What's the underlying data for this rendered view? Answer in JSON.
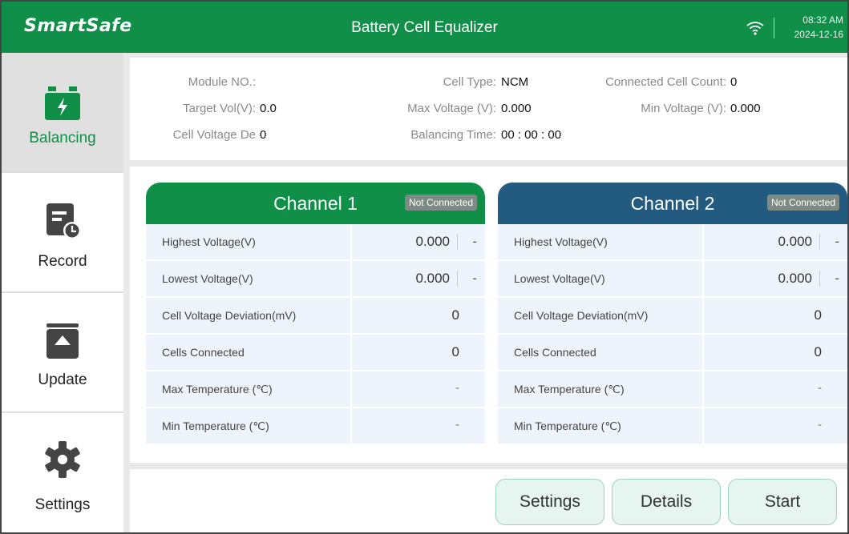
{
  "header": {
    "brand": "SmartSafe",
    "title": "Battery Cell Equalizer",
    "time": "08:32 AM",
    "date": "2024-12-16"
  },
  "sidebar": {
    "items": [
      {
        "label": "Balancing",
        "icon": "battery-charging-icon",
        "active": true
      },
      {
        "label": "Record",
        "icon": "record-clock-icon",
        "active": false
      },
      {
        "label": "Update",
        "icon": "upload-icon",
        "active": false
      },
      {
        "label": "Settings",
        "icon": "gear-icon",
        "active": false
      }
    ]
  },
  "info": {
    "module_no_label": "Module NO.:",
    "module_no_value": "",
    "cell_type_label": "Cell Type:",
    "cell_type_value": "NCM",
    "connected_count_label": "Connected Cell Count:",
    "connected_count_value": "0",
    "target_vol_label": "Target Vol(V):",
    "target_vol_value": "0.0",
    "max_voltage_label": "Max Voltage (V):",
    "max_voltage_value": "0.000",
    "min_voltage_label": "Min Voltage (V):",
    "min_voltage_value": "0.000",
    "cell_dev_label": "Cell Voltage De",
    "cell_dev_value": "0",
    "balancing_time_label": "Balancing Time:",
    "balancing_time_value": "00 : 00 : 00"
  },
  "channels": [
    {
      "title": "Channel 1",
      "status": "Not Connected",
      "rows": [
        {
          "label": "Highest Voltage(V)",
          "value": "0.000",
          "extra": "-"
        },
        {
          "label": "Lowest Voltage(V)",
          "value": "0.000",
          "extra": "-"
        },
        {
          "label": "Cell Voltage Deviation(mV)",
          "value": "0"
        },
        {
          "label": "Cells Connected",
          "value": "0"
        },
        {
          "label": "Max Temperature (℃)",
          "value": "-"
        },
        {
          "label": "Min Temperature (℃)",
          "value": "-"
        }
      ]
    },
    {
      "title": "Channel 2",
      "status": "Not Connected",
      "rows": [
        {
          "label": "Highest Voltage(V)",
          "value": "0.000",
          "extra": "-"
        },
        {
          "label": "Lowest Voltage(V)",
          "value": "0.000",
          "extra": "-"
        },
        {
          "label": "Cell Voltage Deviation(mV)",
          "value": "0"
        },
        {
          "label": "Cells Connected",
          "value": "0"
        },
        {
          "label": "Max Temperature (℃)",
          "value": "-"
        },
        {
          "label": "Min Temperature (℃)",
          "value": "-"
        }
      ]
    }
  ],
  "footer": {
    "settings_label": "Settings",
    "details_label": "Details",
    "start_label": "Start"
  },
  "colors": {
    "brand_green": "#0f8f48",
    "channel1_header": "#0f8f48",
    "channel2_header": "#235b80",
    "active_sidebar_bg": "#e0e0e0",
    "row_bg": "#eef4fb",
    "button_bg": "#e6f5f0"
  }
}
